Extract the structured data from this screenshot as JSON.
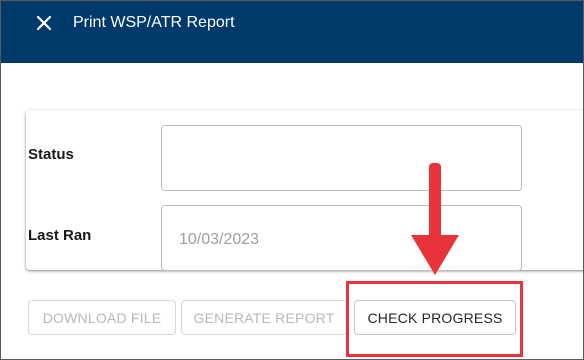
{
  "dialog": {
    "title": "Print WSP/ATR Report",
    "close_icon": "close-icon"
  },
  "form": {
    "status": {
      "label": "Status",
      "value": ""
    },
    "last_ran": {
      "label": "Last Ran",
      "value": "10/03/2023"
    }
  },
  "actions": {
    "download_label": "DOWNLOAD FILE",
    "generate_label": "GENERATE REPORT",
    "check_label": "CHECK PROGRESS"
  },
  "annotation": {
    "arrow_icon": "arrow-down-icon",
    "color": "#e8333a"
  },
  "colors": {
    "header": "#003a6c",
    "accent_red": "#e8333a"
  }
}
